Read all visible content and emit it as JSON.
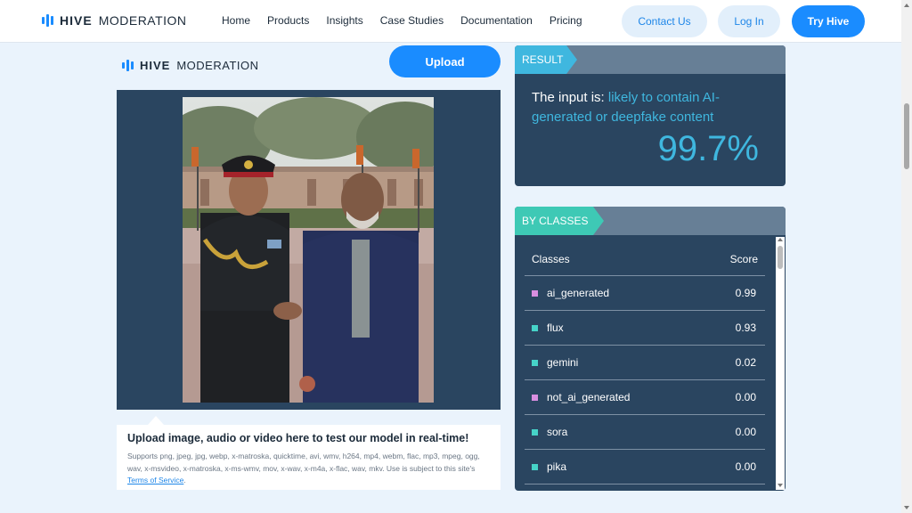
{
  "nav": {
    "logo_bold": "HIVE",
    "logo_light": "MODERATION",
    "links": [
      "Home",
      "Products",
      "Insights",
      "Case Studies",
      "Documentation",
      "Pricing"
    ],
    "contact_label": "Contact Us",
    "login_label": "Log In",
    "try_label": "Try Hive"
  },
  "demo": {
    "logo_bold": "HIVE",
    "logo_light": "MODERATION",
    "upload_label": "Upload",
    "caption_title": "Upload image, audio or video here to test our model in real-time!",
    "caption_text": "Supports png, jpeg, jpg, webp, x-matroska, quicktime, avi, wmv, h264, mp4, webm, flac, mp3, mpeg, ogg, wav, x-msvideo, x-matroska, x-ms-wmv, mov, x-wav, x-m4a, x-flac, wav, mkv. Use is subject to this site's ",
    "tos_link": "Terms of Service",
    "caption_end": "."
  },
  "result": {
    "tag": "RESULT",
    "prefix": "The input is: ",
    "verdict": "likely to contain AI-generated or deepfake content",
    "score": "99.7%"
  },
  "classes": {
    "tag": "BY CLASSES",
    "col_class": "Classes",
    "col_score": "Score",
    "rows": [
      {
        "name": "ai_generated",
        "score": "0.99",
        "color": "#d88ee0"
      },
      {
        "name": "flux",
        "score": "0.93",
        "color": "#46d3c8"
      },
      {
        "name": "gemini",
        "score": "0.02",
        "color": "#46d3c8"
      },
      {
        "name": "not_ai_generated",
        "score": "0.00",
        "color": "#d88ee0"
      },
      {
        "name": "sora",
        "score": "0.00",
        "color": "#46d3c8"
      },
      {
        "name": "pika",
        "score": "0.00",
        "color": "#46d3c8"
      }
    ]
  },
  "colors": {
    "accent": "#1a8cff",
    "result_highlight": "#3fb7df",
    "panel": "#2a4560",
    "classes_tag": "#3ec9b5"
  }
}
